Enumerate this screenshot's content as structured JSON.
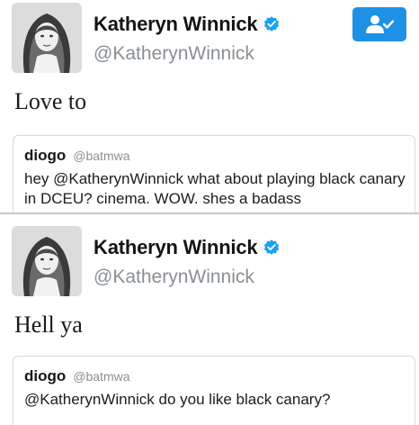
{
  "tweets": [
    {
      "author": {
        "display_name": "Katheryn Winnick",
        "handle": "@KatherynWinnick",
        "verified": true,
        "avatar_icon": "portrait-avatar"
      },
      "follow_button_icon": "follow-user-check-icon",
      "text": "Love to",
      "quote": {
        "display_name": "diogo",
        "handle": "@batmwa",
        "text": "hey @KatherynWinnick what about playing black canary in DCEU? cinema. WOW. shes a badass"
      }
    },
    {
      "author": {
        "display_name": "Katheryn Winnick",
        "handle": "@KatherynWinnick",
        "verified": true,
        "avatar_icon": "portrait-avatar"
      },
      "text": "Hell ya",
      "quote": {
        "display_name": "diogo",
        "handle": "@batmwa",
        "text": "@KatherynWinnick do you like black canary?"
      }
    }
  ],
  "colors": {
    "accent": "#1e90e6",
    "verified_badge": "#1da1f2",
    "secondary_text": "#8a8f95",
    "card_border": "#d6d9dc"
  }
}
